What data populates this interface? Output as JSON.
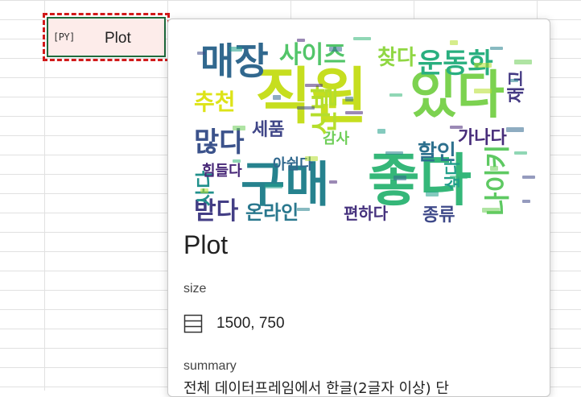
{
  "cell": {
    "icon_text": "[PY]",
    "label": "Plot"
  },
  "card": {
    "title": "Plot",
    "size_label": "size",
    "size_value": "1500, 750",
    "summary_label": "summary",
    "summary_value": "전체 데이터프레임에서 한글(2글자 이상) 단"
  },
  "wordcloud": {
    "words": [
      {
        "text": "직원",
        "color": "#c6de1f"
      },
      {
        "text": "있다",
        "color": "#7cd250"
      },
      {
        "text": "좋다",
        "color": "#35b779"
      },
      {
        "text": "구매",
        "color": "#26828e"
      },
      {
        "text": "매장",
        "color": "#31688e"
      },
      {
        "text": "사이즈",
        "color": "#52c569"
      },
      {
        "text": "운동화",
        "color": "#29af7f"
      },
      {
        "text": "찾다",
        "color": "#90d743"
      },
      {
        "text": "추천",
        "color": "#dde318"
      },
      {
        "text": "많다",
        "color": "#3b528b"
      },
      {
        "text": "세품",
        "color": "#404688"
      },
      {
        "text": "할인",
        "color": "#2d708e"
      },
      {
        "text": "가나다",
        "color": "#472c7a"
      },
      {
        "text": "받다",
        "color": "#433e85"
      },
      {
        "text": "온라인",
        "color": "#2a788e"
      },
      {
        "text": "종류",
        "color": "#3e4989"
      },
      {
        "text": "편하다",
        "color": "#46327e"
      },
      {
        "text": "나이키",
        "color": "#5ec962"
      },
      {
        "text": "사다",
        "color": "#21918c"
      },
      {
        "text": "힘들다",
        "color": "#482878"
      },
      {
        "text": "아쉽다",
        "color": "#31688e"
      },
      {
        "text": "감사",
        "color": "#6ece58"
      },
      {
        "text": "싶다",
        "color": "#1f9e89"
      },
      {
        "text": "신발",
        "color": "#b5de2b"
      },
      {
        "text": "재고",
        "color": "#443983"
      }
    ]
  }
}
